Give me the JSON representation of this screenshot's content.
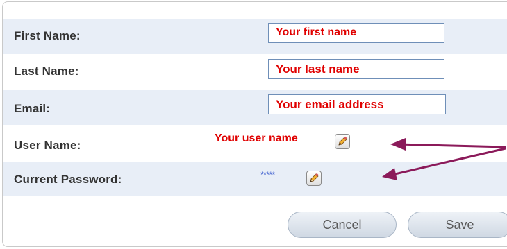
{
  "form": {
    "first_name": {
      "label": "First Name:",
      "value": "Your first name"
    },
    "last_name": {
      "label": "Last Name:",
      "value": "Your last name"
    },
    "email": {
      "label": "Email:",
      "value": "Your email address"
    },
    "user_name": {
      "label": "User Name:",
      "value": "Your user name"
    },
    "password": {
      "label": "Current Password:",
      "value": "*****"
    }
  },
  "buttons": {
    "cancel": "Cancel",
    "save": "Save"
  },
  "colors": {
    "row_shade": "#e8eef7",
    "input_border": "#6f8fb8",
    "placeholder_text": "#e00000",
    "annotation_arrow": "#8b1a5a"
  },
  "icons": [
    "pencil-edit-icon"
  ]
}
